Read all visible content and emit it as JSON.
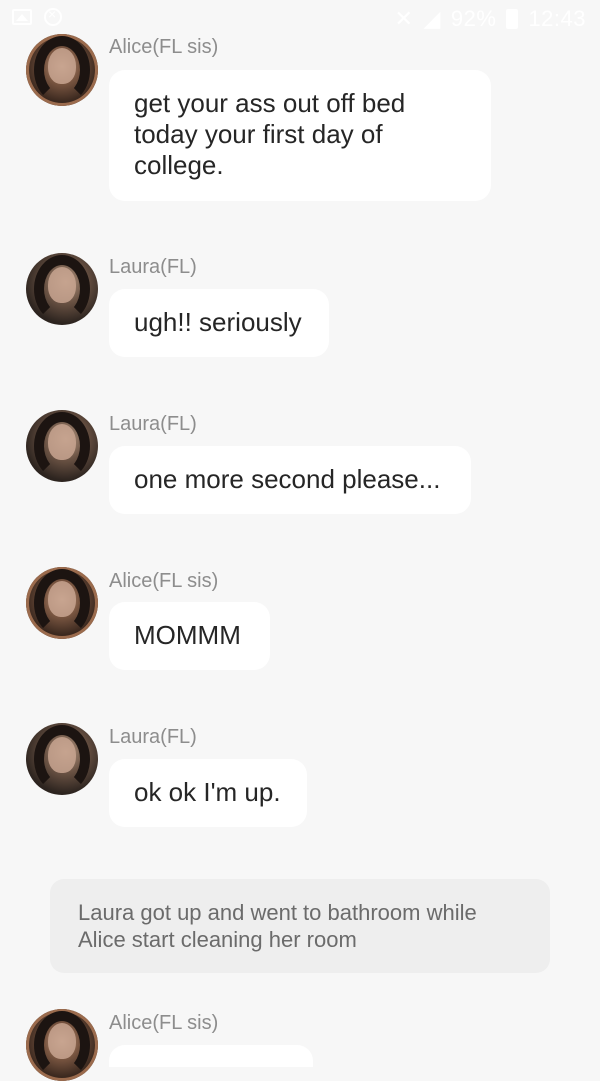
{
  "status_bar": {
    "battery": "92%",
    "time": "12:43"
  },
  "messages": [
    {
      "sender": "Alice(FL sis)",
      "text": "get your ass out off bed today your first day of college."
    },
    {
      "sender": "Laura(FL)",
      "text": "ugh!! seriously"
    },
    {
      "sender": "Laura(FL)",
      "text": "one more second please..."
    },
    {
      "sender": "Alice(FL sis)",
      "text": "MOMMM"
    },
    {
      "sender": "Laura(FL)",
      "text": "ok ok I'm up."
    }
  ],
  "narration": {
    "text": "Laura got up and went to bathroom while Alice start cleaning her room"
  },
  "last_message": {
    "sender": "Alice(FL sis)",
    "text": ""
  }
}
